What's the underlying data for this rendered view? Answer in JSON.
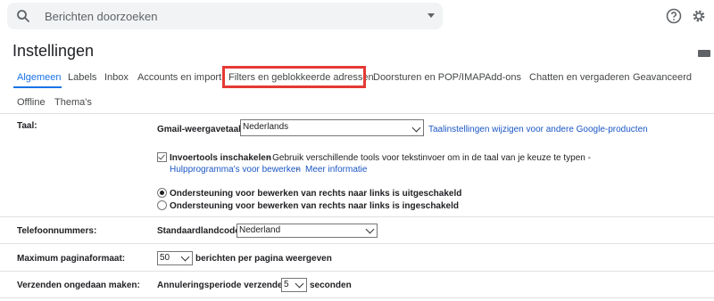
{
  "search": {
    "placeholder": "Berichten doorzoeken"
  },
  "header": {
    "title": "Instellingen"
  },
  "tabs": [
    {
      "label": "Algemeen",
      "active": true
    },
    {
      "label": "Labels"
    },
    {
      "label": "Inbox"
    },
    {
      "label": "Accounts en import"
    },
    {
      "label": "Filters en geblokkeerde adressen",
      "highlighted": true
    },
    {
      "label": "Doorsturen en POP/IMAP"
    },
    {
      "label": "Add-ons"
    },
    {
      "label": "Chatten en vergaderen"
    },
    {
      "label": "Geavanceerd"
    },
    {
      "label": "Offline"
    },
    {
      "label": "Thema's"
    }
  ],
  "language": {
    "label": "Taal:",
    "display_label": "Gmail-weergavetaal:",
    "display_value": "Nederlands",
    "settings_link": "Taalinstellingen wijzigen voor andere Google-producten",
    "input_tools_label": "Invoertools inschakelen",
    "input_tools_desc": " - Gebruik verschillende tools voor tekstinvoer om in de taal van je keuze te typen -",
    "edit_tools_link": "Hulpprogramma's voor bewerken",
    "separator": " - ",
    "more_info_link": "Meer informatie",
    "rtl_off": "Ondersteuning voor bewerken van rechts naar links is uitgeschakeld",
    "rtl_on": "Ondersteuning voor bewerken van rechts naar links is ingeschakeld"
  },
  "phone": {
    "label": "Telefoonnummers:",
    "country_label": "Standaardlandcode:",
    "country_value": "Nederland"
  },
  "page_size": {
    "label": "Maximum paginaformaat:",
    "value": "50",
    "suffix": "berichten per pagina weergeven"
  },
  "undo": {
    "label": "Verzenden ongedaan maken:",
    "period_label": "Annuleringsperiode verzenden:",
    "value": "5",
    "suffix": "seconden"
  },
  "colors": {
    "accent": "#1a73e8",
    "highlight": "#e53935",
    "link": "#1a56c4"
  }
}
